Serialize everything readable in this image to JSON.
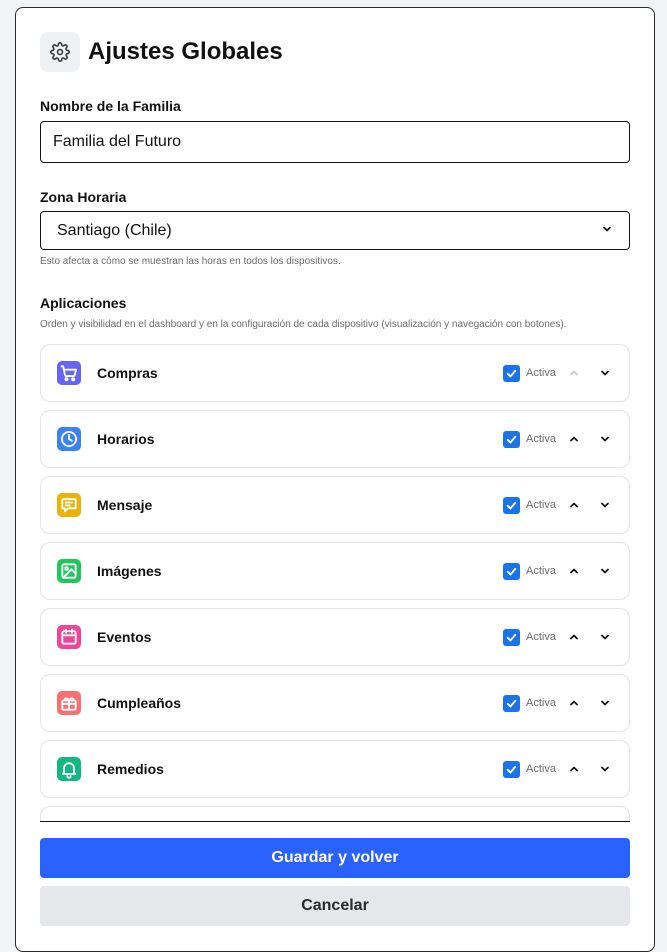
{
  "title": "Ajustes Globales",
  "family": {
    "label": "Nombre de la Familia",
    "value": "Familia del Futuro"
  },
  "timezone": {
    "label": "Zona Horaria",
    "value": "Santiago (Chile)",
    "hint": "Esto afecta a cómo se muestran las horas en todos los dispositivos."
  },
  "apps": {
    "label": "Aplicaciones",
    "hint": "Orden y visibilidad en el dashboard y en la configuración de cada dispositivo (visualización y navegación con botones).",
    "items": [
      {
        "name": "Compras",
        "status": "Activa",
        "icon": "cart-icon",
        "color": "#6366f1",
        "up_disabled": true
      },
      {
        "name": "Horarios",
        "status": "Activa",
        "icon": "clock-icon",
        "color": "#3b82f6",
        "up_disabled": false
      },
      {
        "name": "Mensaje",
        "status": "Activa",
        "icon": "message-icon",
        "color": "#eab308",
        "up_disabled": false
      },
      {
        "name": "Imágenes",
        "status": "Activa",
        "icon": "image-icon",
        "color": "#22c55e",
        "up_disabled": false
      },
      {
        "name": "Eventos",
        "status": "Activa",
        "icon": "calendar-icon",
        "color": "#ec4899",
        "up_disabled": false
      },
      {
        "name": "Cumpleaños",
        "status": "Activa",
        "icon": "gift-icon",
        "color": "#f87171",
        "up_disabled": false
      },
      {
        "name": "Remedios",
        "status": "Activa",
        "icon": "bell-icon",
        "color": "#10b981",
        "up_disabled": false
      }
    ]
  },
  "buttons": {
    "save": "Guardar y volver",
    "cancel": "Cancelar"
  },
  "colors": {
    "primary": "#2962ff",
    "checkbox": "#1a73e8"
  }
}
